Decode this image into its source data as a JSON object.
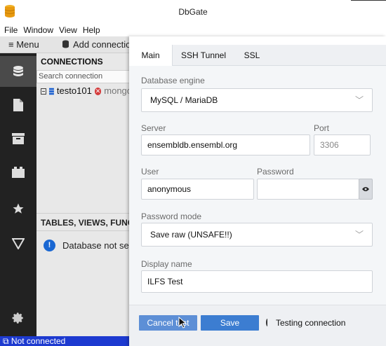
{
  "window": {
    "title": "DbGate"
  },
  "menu": [
    "File",
    "Window",
    "View",
    "Help"
  ],
  "toolbar": {
    "menu_label": "Menu",
    "add_connection_label": "Add connection"
  },
  "sidebar": {
    "icons": [
      "database-icon",
      "file-icon",
      "archive-icon",
      "plugin-icon",
      "star-icon",
      "filter-icon",
      "gear-icon"
    ]
  },
  "connections": {
    "header": "CONNECTIONS",
    "search_placeholder": "Search connection",
    "items": [
      {
        "name": "testo101",
        "type": "mongo"
      }
    ]
  },
  "tables": {
    "header": "TABLES, VIEWS, FUNCTIONS",
    "message": "Database not selected"
  },
  "status": {
    "text": "Not connected"
  },
  "modal": {
    "tabs": [
      "Main",
      "SSH Tunnel",
      "SSL"
    ],
    "active_tab": "Main",
    "engine_label": "Database engine",
    "engine_value": "MySQL / MariaDB",
    "server_label": "Server",
    "server_value": "ensembldb.ensembl.org",
    "port_label": "Port",
    "port_placeholder": "3306",
    "user_label": "User",
    "user_value": "anonymous",
    "password_label": "Password",
    "password_value": "",
    "password_mode_label": "Password mode",
    "password_mode_value": "Save raw (UNSAFE!!)",
    "display_name_label": "Display name",
    "display_name_value": "ILFS Test",
    "cancel_test_label": "Cancel test",
    "save_label": "Save",
    "testing_text": "Testing connection"
  },
  "colors": {
    "accent": "#3c7dd1",
    "statusbar": "#1d3ad0",
    "sidebar": "#222222",
    "error": "#d43b3b",
    "info": "#1a67d2"
  }
}
